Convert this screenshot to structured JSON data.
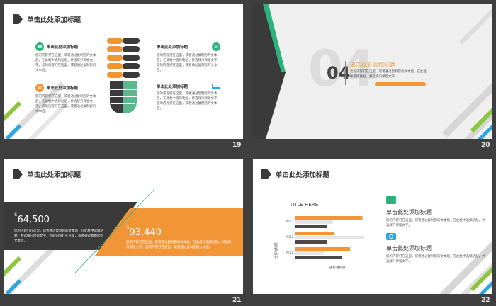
{
  "slides": [
    {
      "number": "19",
      "title": "单击此处添加标题",
      "items": [
        {
          "heading": "单击此处添加标题",
          "text": "您的内容打在这里，或者通过复制您的文本后，在此框中选择粘贴，并选择只保留文字。您的内容打在这里，或者通过复制您的文本后。",
          "icon": "phone-icon",
          "color": "#2db27d"
        },
        {
          "heading": "单击此处添加标题",
          "text": "您的内容打在这里，或者通过复制您的文本后，在此框中选择粘贴，并选择只保留文字。您的内容打在这里，或者通过复制您的文本后。",
          "icon": "chat-icon",
          "color": "#f29537"
        },
        {
          "heading": "单击此处添加标题",
          "text": "您的内容打在这里，或者通过复制您的文本后，在此框中选择粘贴，并选择只保留文字。您的内容打在这里，或者通过复制您的文本后。",
          "icon": "phone-call-icon",
          "color": "#2db27d"
        },
        {
          "heading": "单击此处添加标题",
          "text": "您的内容打在这里，或者通过复制您的文本后，在此框中选择粘贴，并选择只保留文字。您的内容打在这里，或者通过复制您的文本后。",
          "icon": "laptop-icon",
          "color": "#2aa5e0"
        }
      ]
    },
    {
      "number": "20",
      "big_number": "04",
      "small_number": "04",
      "heading": "单击此处添加标题",
      "text": "您的内容打在这里，或者通过复制您的文本后，在此框中选择粘贴，并选择只保留文字。"
    },
    {
      "number": "21",
      "title": "单击此处添加标题",
      "left_value": "64,500",
      "left_currency": "$",
      "left_text": "您的内容打在这里，或者通过复制您的文本后，在此框中选择粘贴，并选择只保留文字。您的内容打在这里，或者通过复制您的文本后。",
      "right_value": "93,440",
      "right_currency": "$",
      "right_text": "您的内容打在这里，或者通过复制您的文本后，在此框中选择粘贴，并选择只保留文字。您的内容打在这里，或者通过复制您的文本后。"
    },
    {
      "number": "22",
      "title": "单击此处添加标题",
      "chart_title": "TITLE HERE",
      "chart_ylabel": "坐标轴标题",
      "chart_xlabel": "坐标轴标题",
      "items": [
        {
          "heading": "单击此处添加标题",
          "text": "您的内容打在这里，或者通过复制您的文本后，在此框中选择粘贴，并选择只保留文字。",
          "icon": "monitor-icon",
          "color": "#2db27d"
        },
        {
          "heading": "单击此处添加标题",
          "text": "您的内容打在这里，或者通过复制您的文本后，在此框中选择粘贴，并选择只保留文字。",
          "icon": "camera-icon",
          "color": "#2aa5e0"
        }
      ]
    }
  ],
  "chart_data": {
    "type": "bar",
    "orientation": "horizontal",
    "title": "TITLE HERE",
    "xlabel": "坐标轴标题",
    "ylabel": "坐标轴标题",
    "categories": [
      "NO.3",
      "NO.2",
      "NO.1"
    ],
    "series": [
      {
        "values": [
          4.3,
          2.5,
          3.5
        ],
        "color": "#f29537"
      },
      {
        "values": [
          2.4,
          4.4,
          1.8
        ],
        "color": "#e5e5e5"
      },
      {
        "values": [
          2,
          2,
          3
        ],
        "color": "#4a4a4a"
      }
    ],
    "xlim": [
      0,
      5
    ]
  }
}
